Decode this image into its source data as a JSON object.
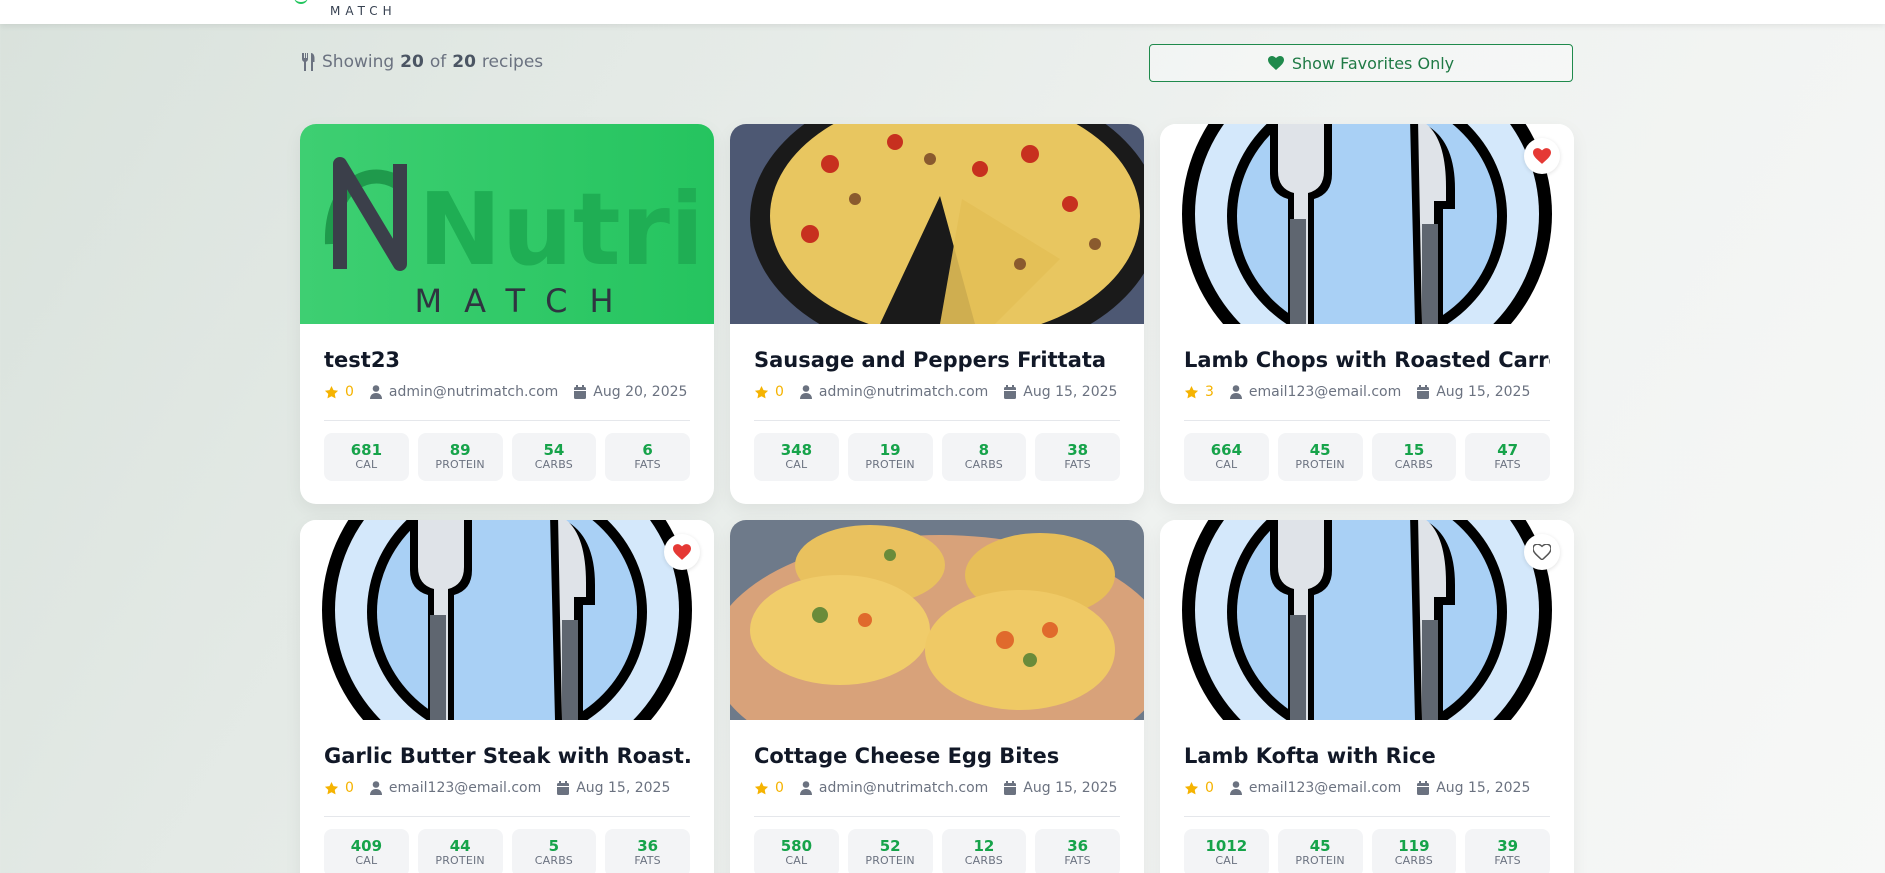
{
  "header": {
    "logo_sub": "MATCH"
  },
  "toolbar": {
    "count_prefix": "Showing",
    "shown": "20",
    "count_of": "of",
    "total": "20",
    "count_suffix": "recipes",
    "favorites_button": "Show Favorites Only"
  },
  "colors": {
    "accent": "#22c55e",
    "heart_active": "#e53935",
    "star": "#f5b301"
  },
  "nutri_logo": {
    "word": "Nutri",
    "sub": "MATCH"
  },
  "macro_labels": {
    "cal": "CAL",
    "protein": "PROTEIN",
    "carbs": "CARBS",
    "fats": "FATS"
  },
  "recipes": [
    {
      "title": "test23",
      "rating": "0",
      "author": "admin@nutrimatch.com",
      "date": "Aug 20, 2025",
      "cal": "681",
      "protein": "89",
      "carbs": "54",
      "fats": "6",
      "image": "nutri-logo",
      "favorite": "none"
    },
    {
      "title": "Sausage and Peppers Frittata",
      "rating": "0",
      "author": "admin@nutrimatch.com",
      "date": "Aug 15, 2025",
      "cal": "348",
      "protein": "19",
      "carbs": "8",
      "fats": "38",
      "image": "frittata-photo",
      "favorite": "none"
    },
    {
      "title": "Lamb Chops with Roasted Carrot...",
      "rating": "3",
      "author": "email123@email.com",
      "date": "Aug 15, 2025",
      "cal": "664",
      "protein": "45",
      "carbs": "15",
      "fats": "47",
      "image": "plate-icon",
      "favorite": "active"
    },
    {
      "title": "Garlic Butter Steak with Roast...",
      "rating": "0",
      "author": "email123@email.com",
      "date": "Aug 15, 2025",
      "cal": "409",
      "protein": "44",
      "carbs": "5",
      "fats": "36",
      "image": "plate-icon",
      "favorite": "active"
    },
    {
      "title": "Cottage Cheese Egg Bites",
      "rating": "0",
      "author": "admin@nutrimatch.com",
      "date": "Aug 15, 2025",
      "cal": "580",
      "protein": "52",
      "carbs": "12",
      "fats": "36",
      "image": "egg-bites-photo",
      "favorite": "none"
    },
    {
      "title": "Lamb Kofta with Rice",
      "rating": "0",
      "author": "email123@email.com",
      "date": "Aug 15, 2025",
      "cal": "1012",
      "protein": "45",
      "carbs": "119",
      "fats": "39",
      "image": "plate-icon",
      "favorite": "inactive"
    }
  ]
}
